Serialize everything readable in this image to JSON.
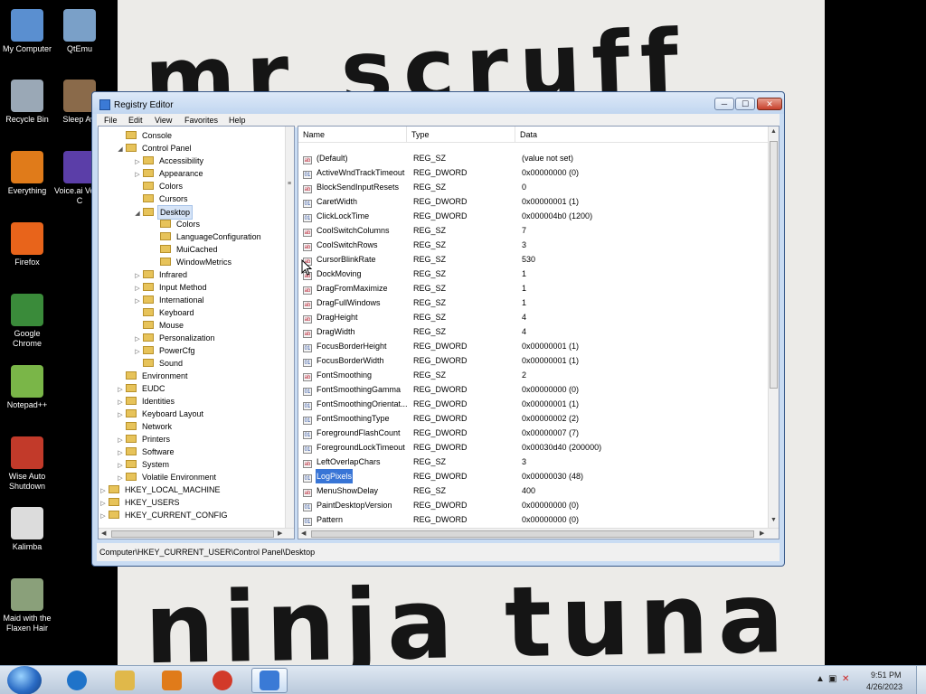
{
  "wallpaper": {
    "top_text": "mr scruff",
    "bottom_text": "ninja tuna"
  },
  "desktop_icons": [
    {
      "label": "My Computer",
      "icon": "computer-icon",
      "color": "#5a8fd0"
    },
    {
      "label": "QtEmu",
      "icon": "qtemu-icon",
      "color": "#7aa0c8"
    },
    {
      "label": "Recycle Bin",
      "icon": "recycle-bin-icon",
      "color": "#9aa8b6"
    },
    {
      "label": "Sleep Aw",
      "icon": "sleep-away-icon",
      "color": "#8a6a4a"
    },
    {
      "label": "Everything",
      "icon": "everything-icon",
      "color": "#e07b1a"
    },
    {
      "label": "Voice.ai Voice C",
      "icon": "voiceai-icon",
      "color": "#5b3ea8"
    },
    {
      "label": "Firefox",
      "icon": "firefox-icon",
      "color": "#e8641b"
    },
    {
      "label": "Google Chrome",
      "icon": "chrome-icon",
      "color": "#3a8b3a"
    },
    {
      "label": "Notepad++",
      "icon": "notepadpp-icon",
      "color": "#7ab648"
    },
    {
      "label": "Wise Auto Shutdown",
      "icon": "wise-shutdown-icon",
      "color": "#c23a2a"
    },
    {
      "label": "Kalimba",
      "icon": "kalimba-icon",
      "color": "#dcdcdc"
    },
    {
      "label": "Maid with the Flaxen Hair",
      "icon": "music-file-icon",
      "color": "#8aa07a"
    }
  ],
  "window": {
    "title": "Registry Editor",
    "minimize": "─",
    "maximize": "☐",
    "close": "✕"
  },
  "menu": [
    "File",
    "Edit",
    "View",
    "Favorites",
    "Help"
  ],
  "tree": [
    {
      "label": "Console",
      "indent": 2,
      "expander": "",
      "selected": false
    },
    {
      "label": "Control Panel",
      "indent": 2,
      "expander": "◢",
      "selected": false
    },
    {
      "label": "Accessibility",
      "indent": 3,
      "expander": "▷",
      "selected": false
    },
    {
      "label": "Appearance",
      "indent": 3,
      "expander": "▷",
      "selected": false
    },
    {
      "label": "Colors",
      "indent": 3,
      "expander": "",
      "selected": false
    },
    {
      "label": "Cursors",
      "indent": 3,
      "expander": "",
      "selected": false
    },
    {
      "label": "Desktop",
      "indent": 3,
      "expander": "◢",
      "selected": true
    },
    {
      "label": "Colors",
      "indent": 4,
      "expander": "",
      "selected": false
    },
    {
      "label": "LanguageConfiguration",
      "indent": 4,
      "expander": "",
      "selected": false
    },
    {
      "label": "MuiCached",
      "indent": 4,
      "expander": "",
      "selected": false
    },
    {
      "label": "WindowMetrics",
      "indent": 4,
      "expander": "",
      "selected": false
    },
    {
      "label": "Infrared",
      "indent": 3,
      "expander": "▷",
      "selected": false
    },
    {
      "label": "Input Method",
      "indent": 3,
      "expander": "▷",
      "selected": false
    },
    {
      "label": "International",
      "indent": 3,
      "expander": "▷",
      "selected": false
    },
    {
      "label": "Keyboard",
      "indent": 3,
      "expander": "",
      "selected": false
    },
    {
      "label": "Mouse",
      "indent": 3,
      "expander": "",
      "selected": false
    },
    {
      "label": "Personalization",
      "indent": 3,
      "expander": "▷",
      "selected": false
    },
    {
      "label": "PowerCfg",
      "indent": 3,
      "expander": "▷",
      "selected": false
    },
    {
      "label": "Sound",
      "indent": 3,
      "expander": "",
      "selected": false
    },
    {
      "label": "Environment",
      "indent": 2,
      "expander": "",
      "selected": false
    },
    {
      "label": "EUDC",
      "indent": 2,
      "expander": "▷",
      "selected": false
    },
    {
      "label": "Identities",
      "indent": 2,
      "expander": "▷",
      "selected": false
    },
    {
      "label": "Keyboard Layout",
      "indent": 2,
      "expander": "▷",
      "selected": false
    },
    {
      "label": "Network",
      "indent": 2,
      "expander": "",
      "selected": false
    },
    {
      "label": "Printers",
      "indent": 2,
      "expander": "▷",
      "selected": false
    },
    {
      "label": "Software",
      "indent": 2,
      "expander": "▷",
      "selected": false
    },
    {
      "label": "System",
      "indent": 2,
      "expander": "▷",
      "selected": false
    },
    {
      "label": "Volatile Environment",
      "indent": 2,
      "expander": "▷",
      "selected": false
    },
    {
      "label": "HKEY_LOCAL_MACHINE",
      "indent": 1,
      "expander": "▷",
      "selected": false
    },
    {
      "label": "HKEY_USERS",
      "indent": 1,
      "expander": "▷",
      "selected": false
    },
    {
      "label": "HKEY_CURRENT_CONFIG",
      "indent": 1,
      "expander": "▷",
      "selected": false
    }
  ],
  "columns": {
    "name": "Name",
    "type": "Type",
    "data": "Data"
  },
  "values": [
    {
      "name": "(Default)",
      "type": "REG_SZ",
      "data": "(value not set)",
      "kind": "ab"
    },
    {
      "name": "ActiveWndTrackTimeout",
      "type": "REG_DWORD",
      "data": "0x00000000 (0)",
      "kind": "bin"
    },
    {
      "name": "BlockSendInputResets",
      "type": "REG_SZ",
      "data": "0",
      "kind": "ab"
    },
    {
      "name": "CaretWidth",
      "type": "REG_DWORD",
      "data": "0x00000001 (1)",
      "kind": "bin"
    },
    {
      "name": "ClickLockTime",
      "type": "REG_DWORD",
      "data": "0x000004b0 (1200)",
      "kind": "bin"
    },
    {
      "name": "CoolSwitchColumns",
      "type": "REG_SZ",
      "data": "7",
      "kind": "ab"
    },
    {
      "name": "CoolSwitchRows",
      "type": "REG_SZ",
      "data": "3",
      "kind": "ab"
    },
    {
      "name": "CursorBlinkRate",
      "type": "REG_SZ",
      "data": "530",
      "kind": "ab"
    },
    {
      "name": "DockMoving",
      "type": "REG_SZ",
      "data": "1",
      "kind": "ab"
    },
    {
      "name": "DragFromMaximize",
      "type": "REG_SZ",
      "data": "1",
      "kind": "ab"
    },
    {
      "name": "DragFullWindows",
      "type": "REG_SZ",
      "data": "1",
      "kind": "ab"
    },
    {
      "name": "DragHeight",
      "type": "REG_SZ",
      "data": "4",
      "kind": "ab"
    },
    {
      "name": "DragWidth",
      "type": "REG_SZ",
      "data": "4",
      "kind": "ab"
    },
    {
      "name": "FocusBorderHeight",
      "type": "REG_DWORD",
      "data": "0x00000001 (1)",
      "kind": "bin"
    },
    {
      "name": "FocusBorderWidth",
      "type": "REG_DWORD",
      "data": "0x00000001 (1)",
      "kind": "bin"
    },
    {
      "name": "FontSmoothing",
      "type": "REG_SZ",
      "data": "2",
      "kind": "ab"
    },
    {
      "name": "FontSmoothingGamma",
      "type": "REG_DWORD",
      "data": "0x00000000 (0)",
      "kind": "bin"
    },
    {
      "name": "FontSmoothingOrientat...",
      "type": "REG_DWORD",
      "data": "0x00000001 (1)",
      "kind": "bin"
    },
    {
      "name": "FontSmoothingType",
      "type": "REG_DWORD",
      "data": "0x00000002 (2)",
      "kind": "bin"
    },
    {
      "name": "ForegroundFlashCount",
      "type": "REG_DWORD",
      "data": "0x00000007 (7)",
      "kind": "bin"
    },
    {
      "name": "ForegroundLockTimeout",
      "type": "REG_DWORD",
      "data": "0x00030d40 (200000)",
      "kind": "bin"
    },
    {
      "name": "LeftOverlapChars",
      "type": "REG_SZ",
      "data": "3",
      "kind": "ab"
    },
    {
      "name": "LogPixels",
      "type": "REG_DWORD",
      "data": "0x00000030 (48)",
      "kind": "bin",
      "selected": true
    },
    {
      "name": "MenuShowDelay",
      "type": "REG_SZ",
      "data": "400",
      "kind": "ab"
    },
    {
      "name": "PaintDesktopVersion",
      "type": "REG_DWORD",
      "data": "0x00000000 (0)",
      "kind": "bin"
    },
    {
      "name": "Pattern",
      "type": "REG_DWORD",
      "data": "0x00000000 (0)",
      "kind": "bin"
    }
  ],
  "statusbar": "Computer\\HKEY_CURRENT_USER\\Control Panel\\Desktop",
  "taskbar": {
    "items": [
      {
        "icon": "internet-explorer-icon",
        "color": "#1f73c9",
        "active": false
      },
      {
        "icon": "file-explorer-icon",
        "color": "#e0b84a",
        "active": false
      },
      {
        "icon": "media-player-icon",
        "color": "#e07b1a",
        "active": false
      },
      {
        "icon": "chrome-icon",
        "color": "#d23a2a",
        "active": false
      },
      {
        "icon": "registry-editor-icon",
        "color": "#3a7ad6",
        "active": true
      }
    ],
    "time": "9:51 PM",
    "date": "4/26/2023"
  }
}
